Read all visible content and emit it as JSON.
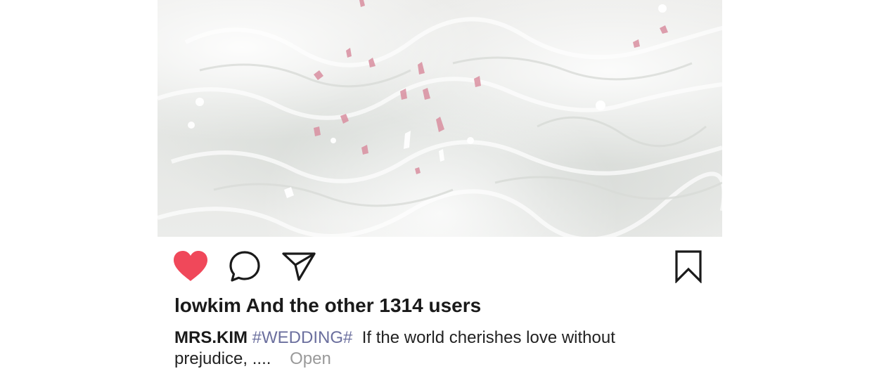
{
  "post": {
    "photo_label": "wedding dress photo",
    "actions": {
      "like_icon": "heart-filled-icon",
      "comment_icon": "comment-bubble-icon",
      "share_icon": "paper-plane-icon",
      "save_icon": "bookmark-icon",
      "like_color": "#f0485a"
    },
    "likes_text": "lowkim And the other 1314 users",
    "caption": {
      "author": "MRS.KIM",
      "hashtag": "#WEDDING#",
      "text": "If the world cherishes love without prejudice, ....",
      "more_label": "Open"
    }
  }
}
